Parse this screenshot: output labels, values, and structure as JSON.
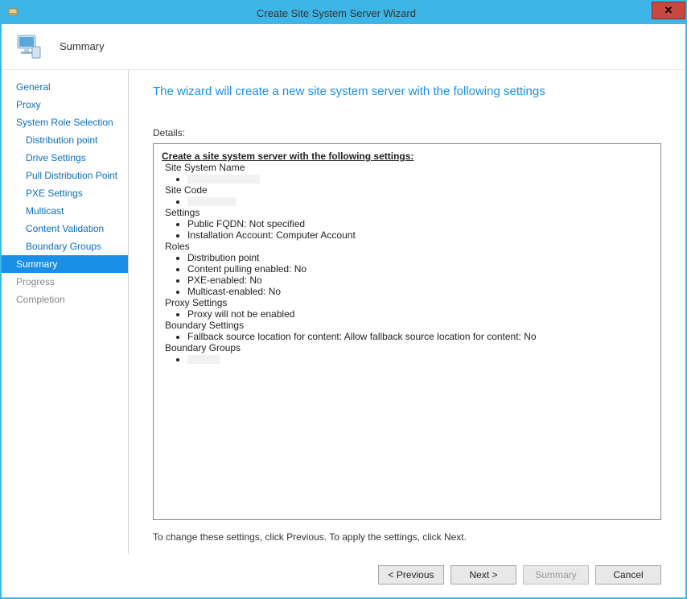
{
  "window": {
    "title": "Create Site System Server Wizard"
  },
  "header": {
    "title": "Summary"
  },
  "sidebar": {
    "items": [
      {
        "label": "General",
        "sub": false,
        "selected": false,
        "dimmed": false
      },
      {
        "label": "Proxy",
        "sub": false,
        "selected": false,
        "dimmed": false
      },
      {
        "label": "System Role Selection",
        "sub": false,
        "selected": false,
        "dimmed": false
      },
      {
        "label": "Distribution point",
        "sub": true,
        "selected": false,
        "dimmed": false
      },
      {
        "label": "Drive Settings",
        "sub": true,
        "selected": false,
        "dimmed": false
      },
      {
        "label": "Pull Distribution Point",
        "sub": true,
        "selected": false,
        "dimmed": false
      },
      {
        "label": "PXE Settings",
        "sub": true,
        "selected": false,
        "dimmed": false
      },
      {
        "label": "Multicast",
        "sub": true,
        "selected": false,
        "dimmed": false
      },
      {
        "label": "Content Validation",
        "sub": true,
        "selected": false,
        "dimmed": false
      },
      {
        "label": "Boundary Groups",
        "sub": true,
        "selected": false,
        "dimmed": false
      },
      {
        "label": "Summary",
        "sub": false,
        "selected": true,
        "dimmed": false
      },
      {
        "label": "Progress",
        "sub": false,
        "selected": false,
        "dimmed": true
      },
      {
        "label": "Completion",
        "sub": false,
        "selected": false,
        "dimmed": true
      }
    ]
  },
  "main": {
    "heading": "The wizard will create a new site system server with the following settings",
    "details_label": "Details:",
    "hint": "To change these settings, click Previous. To apply the settings, click Next.",
    "summary": {
      "title": "Create a site system server with the following settings:",
      "sections": {
        "site_system_name": "Site System Name",
        "site_code": "Site Code",
        "settings": "Settings",
        "settings_items": [
          "Public FQDN: Not specified",
          "Installation Account: Computer Account"
        ],
        "roles": "Roles",
        "roles_items": [
          "Distribution point",
          "Content pulling enabled: No",
          "PXE-enabled: No",
          "Multicast-enabled: No"
        ],
        "proxy": "Proxy Settings",
        "proxy_items": [
          "Proxy will not be enabled"
        ],
        "boundary_settings": "Boundary Settings",
        "boundary_settings_items": [
          "Fallback source location for content: Allow fallback source location for content: No"
        ],
        "boundary_groups": "Boundary Groups"
      }
    }
  },
  "buttons": {
    "previous": "< Previous",
    "next": "Next >",
    "summary": "Summary",
    "cancel": "Cancel"
  }
}
